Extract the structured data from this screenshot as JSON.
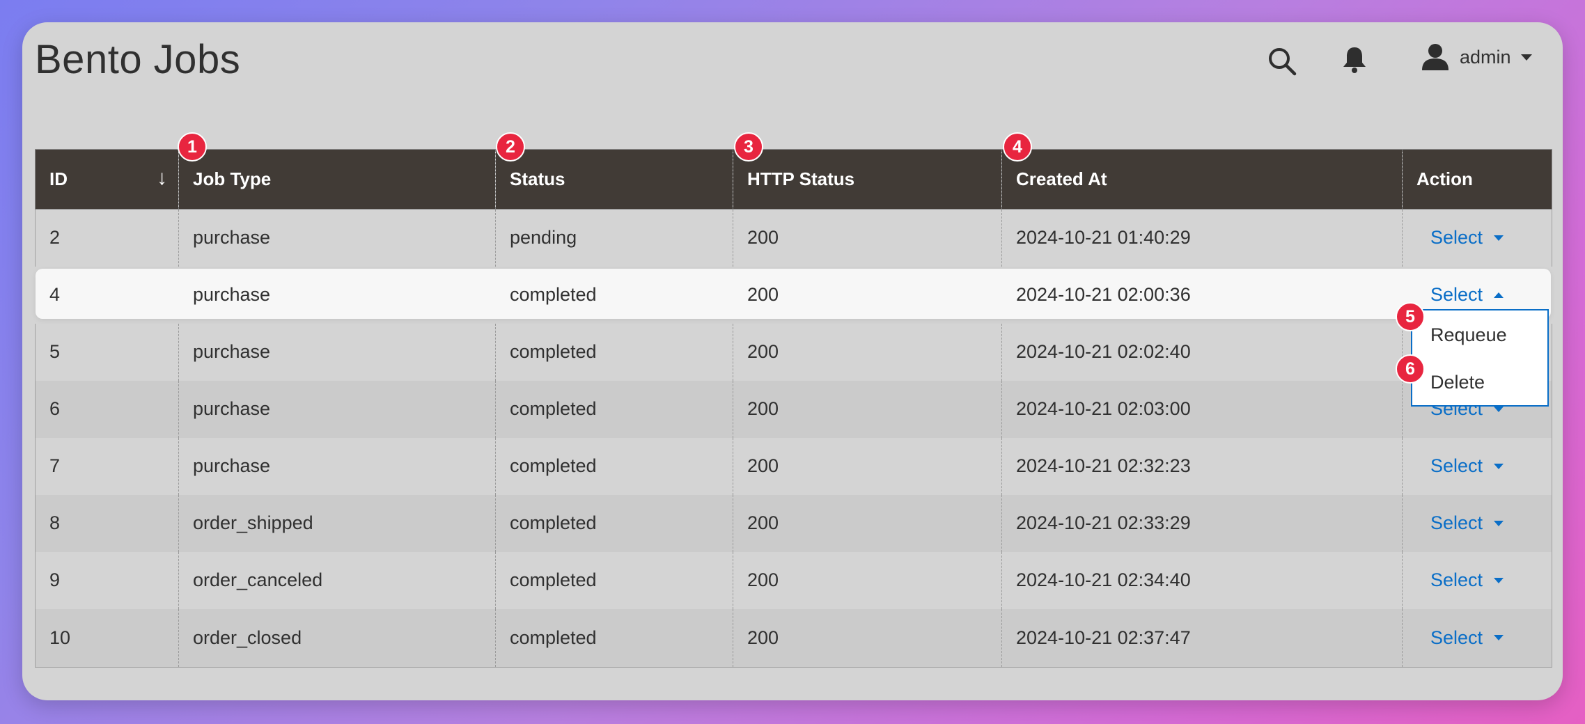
{
  "app": {
    "title": "Bento Jobs"
  },
  "header": {
    "user_name": "admin",
    "icons": [
      "search-icon",
      "bell-icon",
      "user-icon"
    ]
  },
  "colors": {
    "accent": "#0a6ec7",
    "header_bg": "#413b36",
    "badge": "#e8253f"
  },
  "table": {
    "columns": [
      {
        "label": "ID"
      },
      {
        "label": "Job Type"
      },
      {
        "label": "Status"
      },
      {
        "label": "HTTP Status"
      },
      {
        "label": "Created At"
      },
      {
        "label": "Action"
      }
    ],
    "sort_indicator": "↓",
    "action_label": "Select",
    "rows": [
      {
        "id": "2",
        "job_type": "purchase",
        "status": "pending",
        "http_status": "200",
        "created_at": "2024-10-21 01:40:29"
      },
      {
        "id": "4",
        "job_type": "purchase",
        "status": "completed",
        "http_status": "200",
        "created_at": "2024-10-21 02:00:36"
      },
      {
        "id": "5",
        "job_type": "purchase",
        "status": "completed",
        "http_status": "200",
        "created_at": "2024-10-21 02:02:40"
      },
      {
        "id": "6",
        "job_type": "purchase",
        "status": "completed",
        "http_status": "200",
        "created_at": "2024-10-21 02:03:00"
      },
      {
        "id": "7",
        "job_type": "purchase",
        "status": "completed",
        "http_status": "200",
        "created_at": "2024-10-21 02:32:23"
      },
      {
        "id": "8",
        "job_type": "order_shipped",
        "status": "completed",
        "http_status": "200",
        "created_at": "2024-10-21 02:33:29"
      },
      {
        "id": "9",
        "job_type": "order_canceled",
        "status": "completed",
        "http_status": "200",
        "created_at": "2024-10-21 02:34:40"
      },
      {
        "id": "10",
        "job_type": "order_closed",
        "status": "completed",
        "http_status": "200",
        "created_at": "2024-10-21 02:37:47"
      }
    ]
  },
  "dropdown": {
    "items": [
      {
        "label": "Requeue"
      },
      {
        "label": "Delete"
      }
    ]
  },
  "badges": [
    "1",
    "2",
    "3",
    "4",
    "5",
    "6"
  ]
}
